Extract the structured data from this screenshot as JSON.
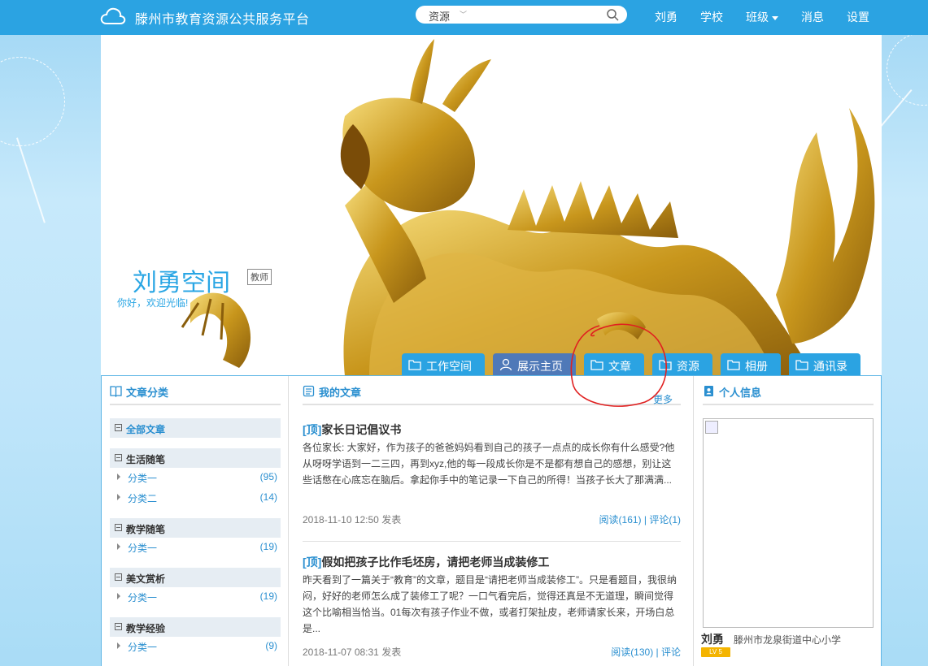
{
  "header": {
    "site_title": "滕州市教育资源公共服务平台",
    "search": {
      "scope": "资源",
      "placeholder": "",
      "value": ""
    },
    "nav": [
      "刘勇",
      "学校",
      "班级",
      "消息",
      "设置"
    ],
    "accent": "#2ba3e2"
  },
  "banner": {
    "space_title": "刘勇空间",
    "role": "教师",
    "welcome": "你好，欢迎光临!",
    "tabs": [
      {
        "label": "工作空间",
        "icon": "folder-icon"
      },
      {
        "label": "展示主页",
        "icon": "user-icon"
      },
      {
        "label": "文章",
        "icon": "folder-icon"
      },
      {
        "label": "资源",
        "icon": "folder-icon"
      },
      {
        "label": "相册",
        "icon": "folder-icon"
      },
      {
        "label": "通讯录",
        "icon": "folder-icon"
      }
    ],
    "active_tab": "展示主页"
  },
  "categories": {
    "heading": "文章分类",
    "all_label": "全部文章",
    "groups": [
      {
        "name": "生活随笔",
        "subs": [
          {
            "name": "分类一",
            "count": "(95)"
          },
          {
            "name": "分类二",
            "count": "(14)"
          }
        ]
      },
      {
        "name": "教学随笔",
        "subs": [
          {
            "name": "分类一",
            "count": "(19)"
          }
        ]
      },
      {
        "name": "美文赏析",
        "subs": [
          {
            "name": "分类一",
            "count": "(19)"
          }
        ]
      },
      {
        "name": "教学经验",
        "subs": [
          {
            "name": "分类一",
            "count": "(9)"
          }
        ]
      }
    ]
  },
  "articles": {
    "heading": "我的文章",
    "more": "更多",
    "items": [
      {
        "top": "[顶]",
        "title": "家长日记倡议书",
        "excerpt": "各位家长: 大家好，作为孩子的爸爸妈妈看到自己的孩子一点点的成长你有什么感受?他从呀呀学语到一二三四，再到xyz,他的每一段成长你是不是都有想自己的感想，别让这些话憋在心底忘在脑后。拿起你手中的笔记录一下自己的所得！当孩子长大了那满满...",
        "date": "2018-11-10 12:50",
        "posted": "发表",
        "stats": "阅读(161) | 评论(1)"
      },
      {
        "top": "[顶]",
        "title": "假如把孩子比作毛坯房，请把老师当成装修工",
        "excerpt": "昨天看到了一篇关于“教育”的文章，题目是“请把老师当成装修工”。只是看题目，我很纳闷，好好的老师怎么成了装修工了呢？一口气看完后，觉得还真是不无道理，瞬间觉得这个比喻相当恰当。01每次有孩子作业不做，或者打架扯皮，老师请家长来，开场白总是...",
        "date": "2018-11-07 08:31",
        "posted": "发表",
        "stats": "阅读(130) | 评论"
      }
    ]
  },
  "profile": {
    "heading": "个人信息",
    "name": "刘勇",
    "school": "滕州市龙泉街道中心小学",
    "level": "LV 5"
  }
}
